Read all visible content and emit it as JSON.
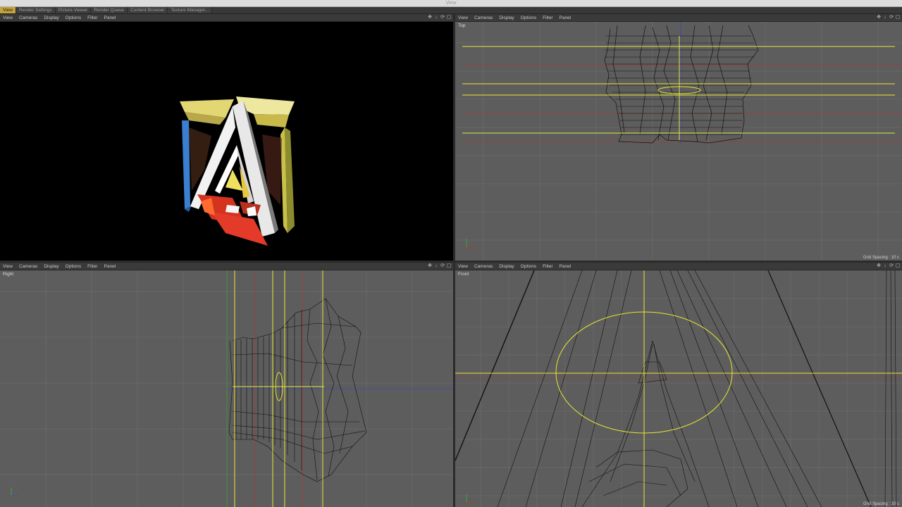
{
  "window": {
    "title": "View"
  },
  "tabs": [
    {
      "label": "View",
      "active": true
    },
    {
      "label": "Render Settings",
      "active": false
    },
    {
      "label": "Picture Viewer",
      "active": false
    },
    {
      "label": "Render Queue",
      "active": false
    },
    {
      "label": "Content Browser",
      "active": false
    },
    {
      "label": "Texture Manager...",
      "active": false
    }
  ],
  "viewport_menu": [
    "View",
    "Cameras",
    "Display",
    "Options",
    "Filter",
    "Panel"
  ],
  "viewports": {
    "perspective": {
      "label": ""
    },
    "top": {
      "label": "Top",
      "grid_spacing": "Grid Spacing : 10 c"
    },
    "right": {
      "label": "Right"
    },
    "front": {
      "label": "Front",
      "grid_spacing": "Grid Spacing : 10 c"
    }
  },
  "colors": {
    "tab_active": "#c7a239",
    "viewport_bg": "#5d5d5d",
    "grid_line": "#6a6a6a",
    "wireframe": "#111111",
    "selection": "#e6e632",
    "axis_red": "#b33a2a",
    "axis_green": "#3aa43a",
    "axis_blue": "#3a4ab3"
  },
  "icons": [
    "move-icon",
    "arrow-down-icon",
    "rotate-icon",
    "maximize-icon"
  ]
}
